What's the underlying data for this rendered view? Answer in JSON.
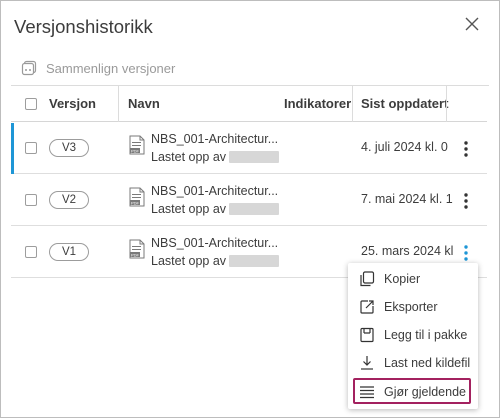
{
  "dialog": {
    "title": "Versjonshistorikk",
    "compare_label": "Sammenlign versjoner"
  },
  "table": {
    "headers": {
      "version": "Versjon",
      "name": "Navn",
      "indicators": "Indikatorer",
      "last_updated": "Sist oppdatert"
    },
    "rows": [
      {
        "version": "V3",
        "name": "NBS_001-Architectur...",
        "uploaded_by": "Lastet opp av",
        "date": "4. juli 2024 kl. 0",
        "selected": true
      },
      {
        "version": "V2",
        "name": "NBS_001-Architectur...",
        "uploaded_by": "Lastet opp av",
        "date": "7. mai 2024 kl. 1",
        "selected": false
      },
      {
        "version": "V1",
        "name": "NBS_001-Architectur...",
        "uploaded_by": "Lastet opp av",
        "date": "25. mars 2024 kl.",
        "selected": false
      }
    ]
  },
  "menu": {
    "items": [
      {
        "label": "Kopier",
        "icon": "copy-icon"
      },
      {
        "label": "Eksporter",
        "icon": "export-icon"
      },
      {
        "label": "Legg til i pakke",
        "icon": "package-icon"
      },
      {
        "label": "Last ned kildefil",
        "icon": "download-icon"
      },
      {
        "label": "Gjør gjeldende",
        "icon": "make-current-icon"
      }
    ]
  },
  "colors": {
    "accent": "#1e96d6",
    "highlight": "#a3215f",
    "text": "#3c3c3c",
    "muted": "#9a9a9a"
  }
}
